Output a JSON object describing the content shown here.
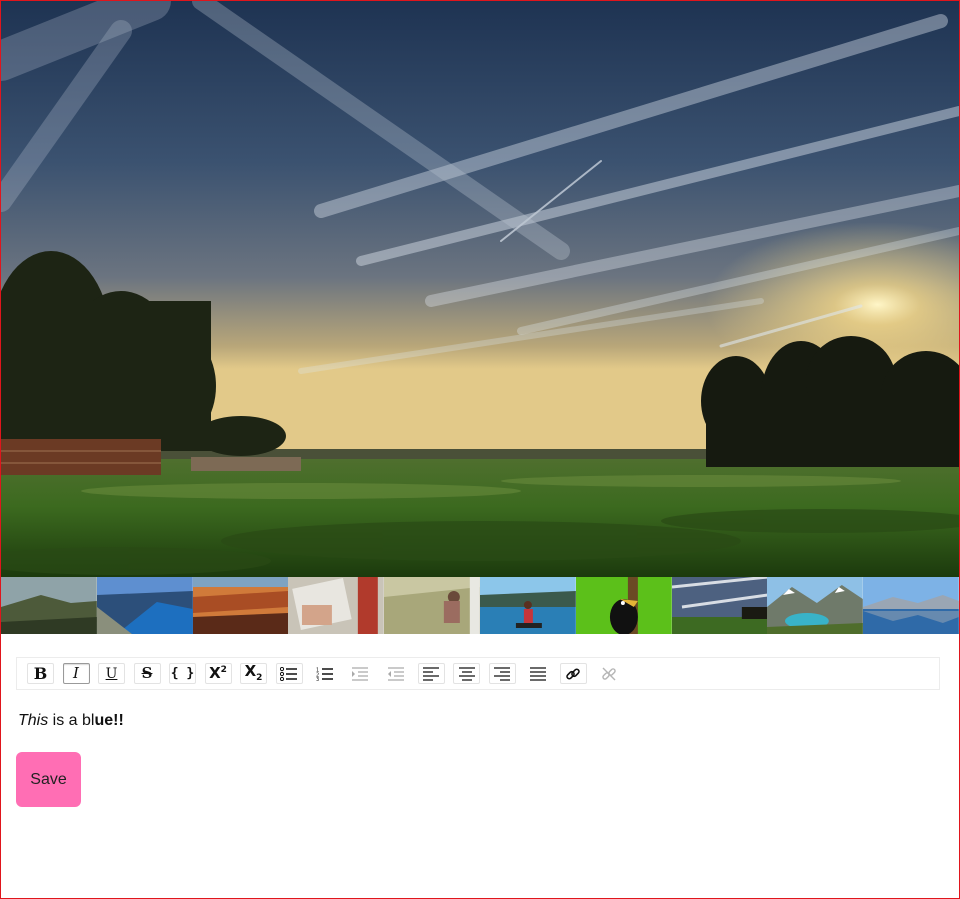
{
  "hero": {
    "alt_icon": "landscape-photo"
  },
  "thumbnails": [
    {
      "name": "cliffs-coast"
    },
    {
      "name": "fjord-blue"
    },
    {
      "name": "red-canyon"
    },
    {
      "name": "van-window"
    },
    {
      "name": "girl-in-grass"
    },
    {
      "name": "lake-kayak"
    },
    {
      "name": "toucan-bird"
    },
    {
      "name": "sky-field"
    },
    {
      "name": "mountain-lake"
    },
    {
      "name": "alpine-reflection"
    }
  ],
  "toolbar": {
    "bold": "B",
    "italic": "I",
    "underline": "U",
    "strike": "S",
    "code": "{ }",
    "superscript_base": "X",
    "superscript_mark": "2",
    "subscript_base": "X",
    "subscript_mark": "2",
    "icons": [
      "bullet-list-icon",
      "numbered-list-icon",
      "indent-icon",
      "outdent-icon",
      "align-left-icon",
      "align-center-icon",
      "align-right-icon",
      "align-justify-icon",
      "link-icon",
      "unlink-icon"
    ]
  },
  "editor": {
    "italic_part": "This",
    "middle_part": " is a bl",
    "bold_part": "ue!!"
  },
  "save_label": "Save",
  "colors": {
    "accent": "#ff6eb4",
    "border": "#e0151c"
  }
}
